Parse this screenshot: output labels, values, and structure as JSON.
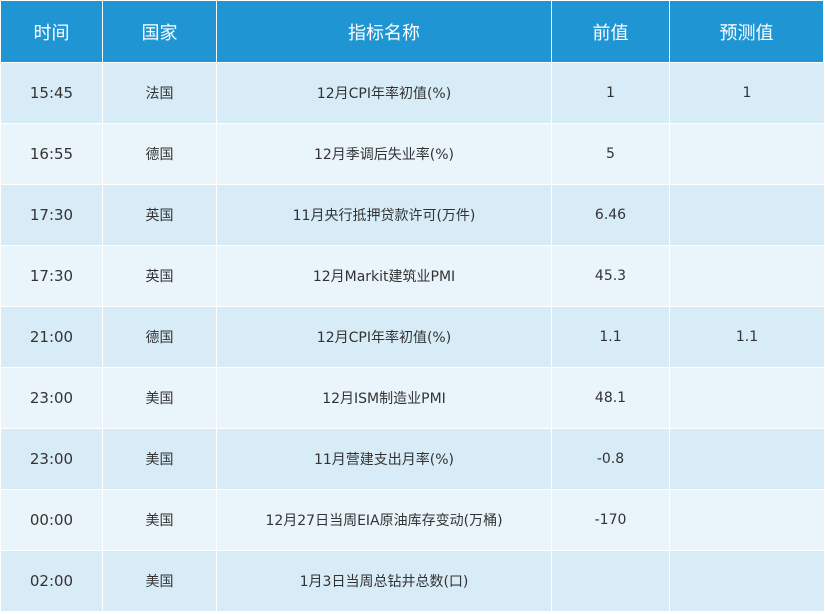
{
  "header": {
    "time": "时间",
    "country": "国家",
    "indicator": "指标名称",
    "previous": "前值",
    "forecast": "预测值"
  },
  "rows": [
    {
      "time": "15:45",
      "country": "法国",
      "indicator": "12月CPI年率初值(%)",
      "previous": "1",
      "forecast": "1"
    },
    {
      "time": "16:55",
      "country": "德国",
      "indicator": "12月季调后失业率(%)",
      "previous": "5",
      "forecast": ""
    },
    {
      "time": "17:30",
      "country": "英国",
      "indicator": "11月央行抵押贷款许可(万件)",
      "previous": "6.46",
      "forecast": ""
    },
    {
      "time": "17:30",
      "country": "英国",
      "indicator": "12月Markit建筑业PMI",
      "previous": "45.3",
      "forecast": ""
    },
    {
      "time": "21:00",
      "country": "德国",
      "indicator": "12月CPI年率初值(%)",
      "previous": "1.1",
      "forecast": "1.1"
    },
    {
      "time": "23:00",
      "country": "美国",
      "indicator": "12月ISM制造业PMI",
      "previous": "48.1",
      "forecast": ""
    },
    {
      "time": "23:00",
      "country": "美国",
      "indicator": "11月营建支出月率(%)",
      "previous": "-0.8",
      "forecast": ""
    },
    {
      "time": "00:00",
      "country": "美国",
      "indicator": "12月27日当周EIA原油库存变动(万桶)",
      "previous": "-170",
      "forecast": ""
    },
    {
      "time": "02:00",
      "country": "美国",
      "indicator": "1月3日当周总钻井总数(口)",
      "previous": "",
      "forecast": ""
    }
  ],
  "colors": {
    "header_bg": "#1f96d3",
    "row_odd_bg": "#d8ecf7",
    "row_even_bg": "#eaf5fb"
  }
}
